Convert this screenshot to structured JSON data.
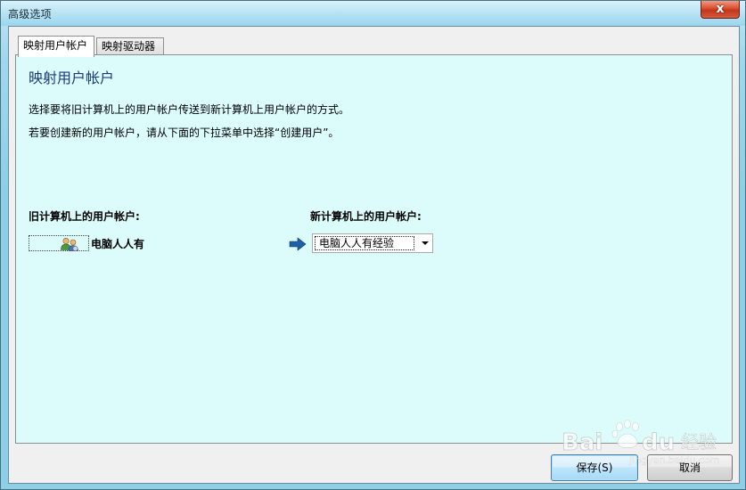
{
  "window": {
    "title": "高级选项",
    "close_glyph": "x"
  },
  "tabs": [
    {
      "label": "映射用户帐户",
      "active": true
    },
    {
      "label": "映射驱动器",
      "active": false
    }
  ],
  "panel": {
    "title": "映射用户帐户",
    "instruction_1": "选择要将旧计算机上的用户帐户传送到新计算机上用户帐户的方式。",
    "instruction_2": "若要创建新的用户帐户，请从下面的下拉菜单中选择“创建用户”。"
  },
  "mapping": {
    "old_header": "旧计算机上的用户帐户:",
    "new_header": "新计算机上的用户帐户:",
    "old_account_name": "电脑人人有",
    "new_account_selected": "电脑人人有经验",
    "icons": {
      "old_account": "users-icon",
      "map_arrow": "arrow-right-icon",
      "dropdown": "chevron-down-icon"
    }
  },
  "buttons": {
    "run_label": "保存(S)",
    "cancel_label": "取消"
  },
  "watermark": {
    "brand": "Bai",
    "brand_suffix": "du",
    "cn": "经验",
    "url": "jingyan.baidu.com"
  },
  "colors": {
    "panel_bg": "#dcfcfc",
    "title_blue": "#1a3a7a",
    "arrow_blue": "#1f5fa8",
    "close_red": "#c2361b"
  }
}
